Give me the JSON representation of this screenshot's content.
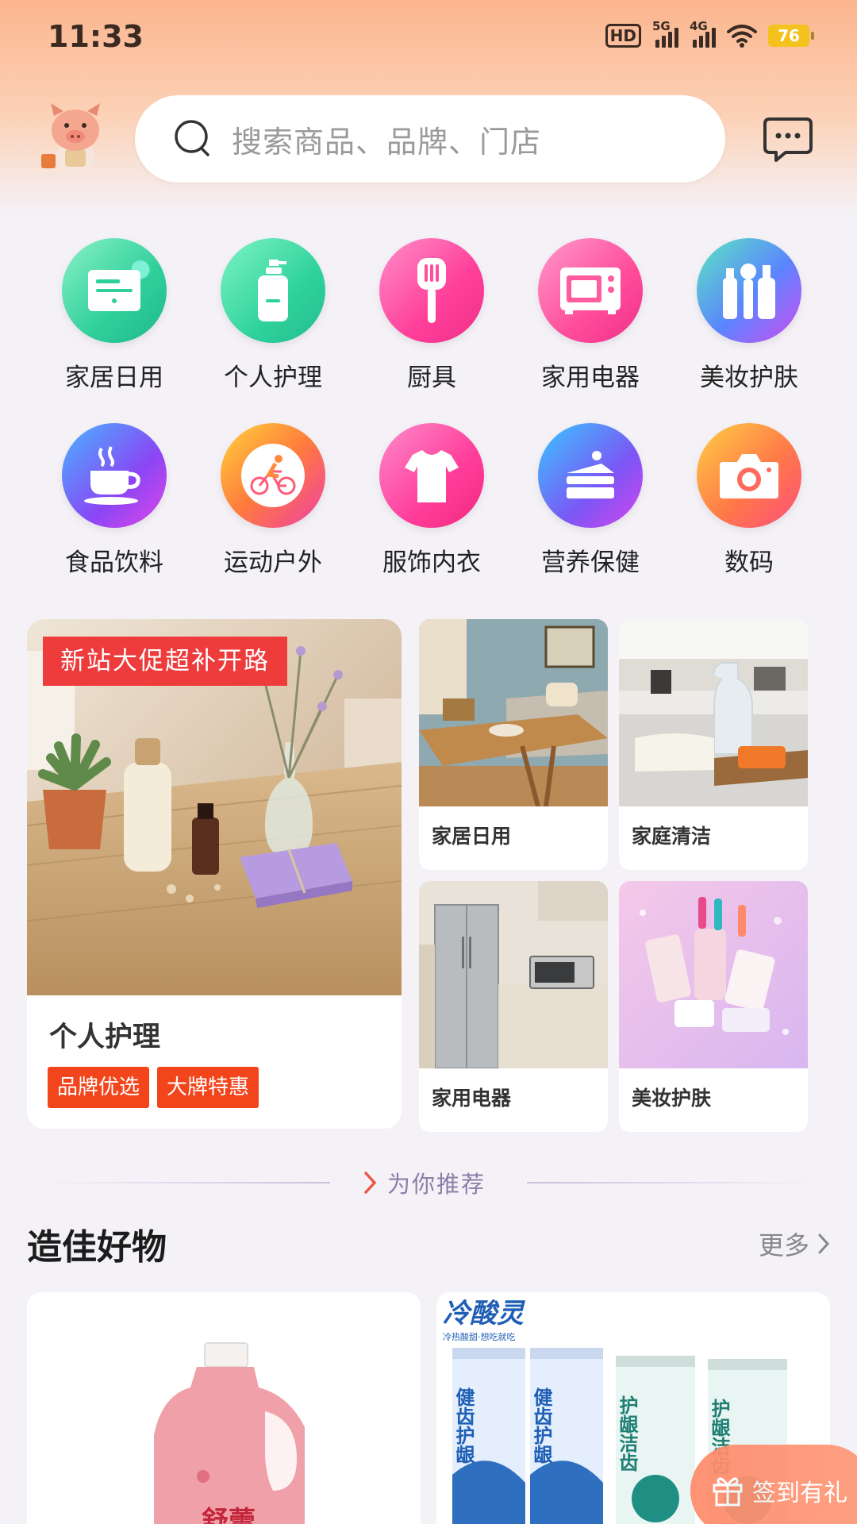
{
  "status_bar": {
    "time": "11:33",
    "network_1": "5G",
    "network_2": "4G",
    "hd_label": "HD",
    "battery": "76",
    "battery_color": "#f3c21c"
  },
  "header": {
    "search_placeholder": "搜索商品、品牌、门店",
    "avatar_icon": "pig-mascot-icon",
    "message_icon": "chat-bubble-icon"
  },
  "categories": [
    {
      "label": "家居日用",
      "icon": "home-card-icon"
    },
    {
      "label": "个人护理",
      "icon": "bottle-icon"
    },
    {
      "label": "厨具",
      "icon": "spatula-icon"
    },
    {
      "label": "家用电器",
      "icon": "oven-icon"
    },
    {
      "label": "美妆护肤",
      "icon": "cosmetics-icon"
    },
    {
      "label": "食品饮料",
      "icon": "coffee-cup-icon"
    },
    {
      "label": "运动户外",
      "icon": "cyclist-icon"
    },
    {
      "label": "服饰内衣",
      "icon": "shirt-icon"
    },
    {
      "label": "营养保健",
      "icon": "cake-icon"
    },
    {
      "label": "数码",
      "icon": "camera-icon"
    }
  ],
  "promo": {
    "banner_ribbon": "新站大促超补开路",
    "big_title": "个人护理",
    "tags": [
      "品牌优选",
      "大牌特惠"
    ],
    "tiles": [
      {
        "label": "家居日用"
      },
      {
        "label": "家庭清洁"
      },
      {
        "label": "家用电器"
      },
      {
        "label": "美妆护肤"
      }
    ]
  },
  "recommend": {
    "label": "为你推荐"
  },
  "section": {
    "title": "造佳好物",
    "more": "更多"
  },
  "products": [
    {
      "brand": "舒蕾"
    },
    {
      "brand": "冷酸灵",
      "subtitle": "冷热酸甜·想吃就吃",
      "tube_labels": [
        "健齿护龈",
        "健齿护龈",
        "护龈洁齿",
        "护龈洁齿"
      ]
    }
  ],
  "floating": {
    "signin_label": "签到有礼"
  },
  "colors": {
    "accent_red": "#ee3b3b",
    "tag_orange": "#f2451c",
    "header_gradient_top": "#fbb58e"
  }
}
